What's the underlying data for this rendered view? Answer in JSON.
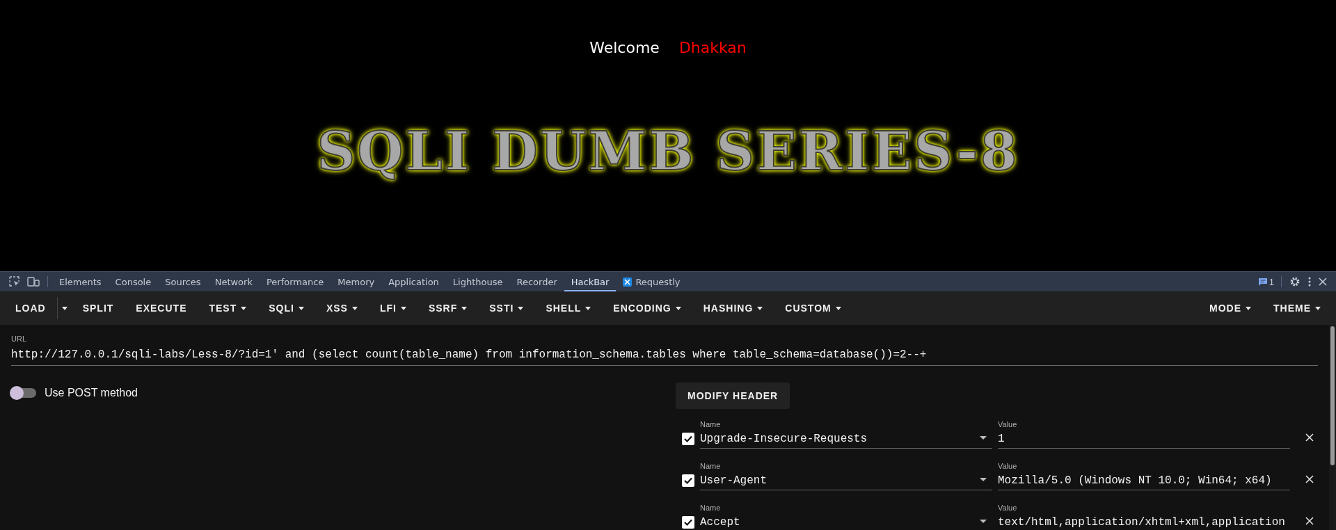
{
  "page": {
    "welcome": "Welcome",
    "username": "Dhakkan",
    "title": "SQLI DUMB SERIES-8"
  },
  "devtools": {
    "tabs": [
      {
        "label": "Elements",
        "selected": false
      },
      {
        "label": "Console",
        "selected": false
      },
      {
        "label": "Sources",
        "selected": false
      },
      {
        "label": "Network",
        "selected": false
      },
      {
        "label": "Performance",
        "selected": false
      },
      {
        "label": "Memory",
        "selected": false
      },
      {
        "label": "Application",
        "selected": false
      },
      {
        "label": "Lighthouse",
        "selected": false
      },
      {
        "label": "Recorder",
        "selected": false
      },
      {
        "label": "HackBar",
        "selected": true
      },
      {
        "label": "Requestly",
        "selected": false,
        "kind": "extension"
      }
    ],
    "issues_count": "1"
  },
  "hackbar": {
    "menu": [
      {
        "label": "LOAD",
        "kind": "split"
      },
      {
        "label": "SPLIT",
        "kind": "button"
      },
      {
        "label": "EXECUTE",
        "kind": "button"
      },
      {
        "label": "TEST",
        "kind": "menu"
      },
      {
        "label": "SQLI",
        "kind": "menu"
      },
      {
        "label": "XSS",
        "kind": "menu"
      },
      {
        "label": "LFI",
        "kind": "menu"
      },
      {
        "label": "SSRF",
        "kind": "menu"
      },
      {
        "label": "SSTI",
        "kind": "menu"
      },
      {
        "label": "SHELL",
        "kind": "menu"
      },
      {
        "label": "ENCODING",
        "kind": "menu"
      },
      {
        "label": "HASHING",
        "kind": "menu"
      },
      {
        "label": "CUSTOM",
        "kind": "menu"
      }
    ],
    "right_menu": [
      {
        "label": "MODE",
        "kind": "menu"
      },
      {
        "label": "THEME",
        "kind": "menu"
      }
    ],
    "url": {
      "label": "URL",
      "value": "http://127.0.0.1/sqli-labs/Less-8/?id=1' and (select count(table_name) from information_schema.tables where table_schema=database())=2--+"
    },
    "post_toggle": {
      "label": "Use POST method",
      "on": false
    },
    "modify_header": "MODIFY HEADER",
    "headers": [
      {
        "checked": true,
        "name_label": "Name",
        "name": "Upgrade-Insecure-Requests",
        "value_label": "Value",
        "value": "1"
      },
      {
        "checked": true,
        "name_label": "Name",
        "name": "User-Agent",
        "value_label": "Value",
        "value": "Mozilla/5.0 (Windows NT 10.0; Win64; x64)"
      },
      {
        "checked": true,
        "name_label": "Name",
        "name": "Accept",
        "value_label": "Value",
        "value": "text/html,application/xhtml+xml,application"
      }
    ]
  }
}
